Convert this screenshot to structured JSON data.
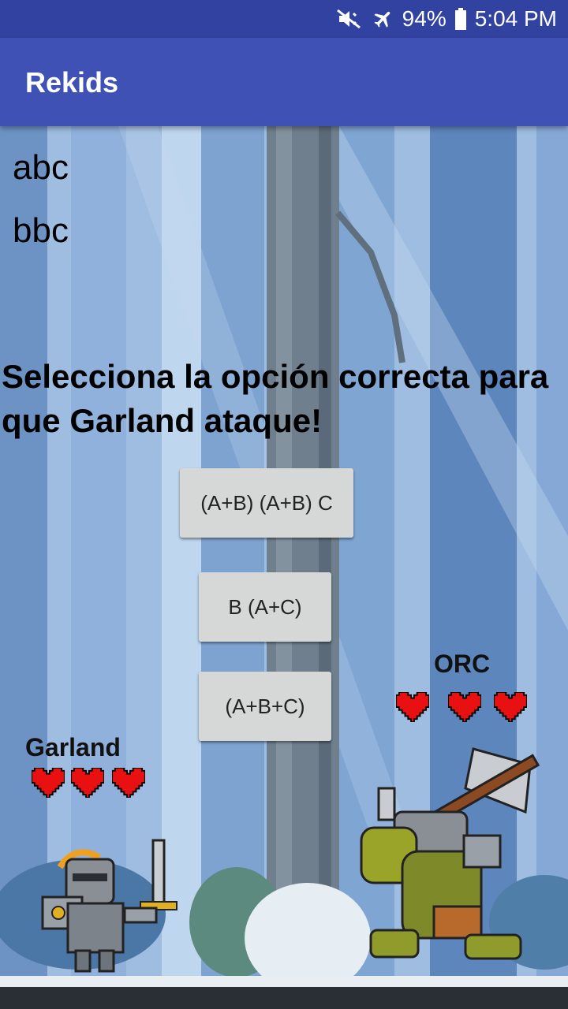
{
  "status": {
    "battery": "94%",
    "time": "5:04 PM",
    "icons": [
      "mute-icon",
      "airplane-icon",
      "battery-icon"
    ]
  },
  "app": {
    "title": "Rekids"
  },
  "labels": {
    "a": "abc",
    "b": "bbc"
  },
  "question": "Selecciona la opción correcta para que Garland ataque!",
  "options": [
    "(A+B) (A+B) C",
    "B (A+C)",
    "(A+B+C)"
  ],
  "player": {
    "name": "Garland",
    "hearts": 3
  },
  "enemy": {
    "name": "ORC",
    "hearts": 3
  },
  "colors": {
    "statusbar": "#3242a0",
    "appbar": "#3f51b5",
    "button": "#d6d7d7",
    "heart": "#e81010"
  }
}
